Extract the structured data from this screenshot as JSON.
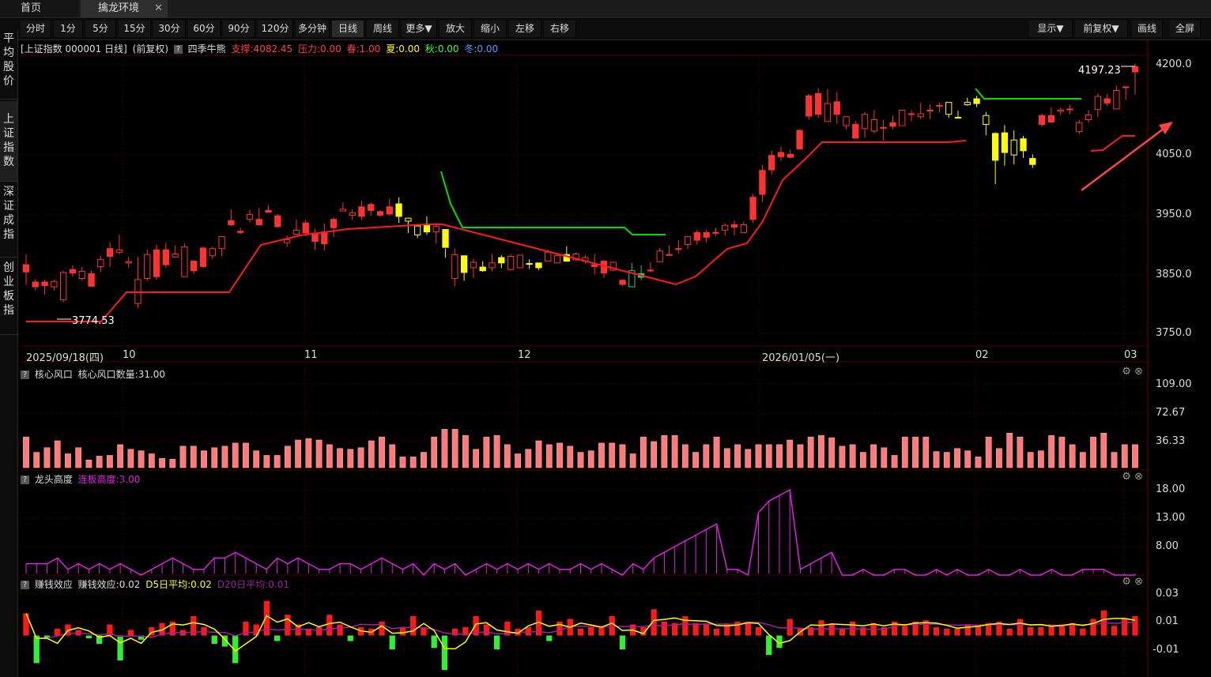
{
  "tabs": {
    "home": "首页",
    "active": "擒龙环境",
    "close_glyph": "✕"
  },
  "toolbar": {
    "left": [
      "分时",
      "1分",
      "5分",
      "15分",
      "30分",
      "60分",
      "90分",
      "120分",
      "多分钟",
      "日线",
      "周线",
      "更多▼",
      "放大",
      "缩小",
      "左移",
      "右移"
    ],
    "active": "日线",
    "right": [
      "显示▼",
      "前复权▼",
      "画线",
      "全屏"
    ]
  },
  "sidebar": [
    {
      "label": "平均股价",
      "chars": [
        "平",
        "均",
        "股",
        "价"
      ]
    },
    {
      "label": "上证指数",
      "chars": [
        "上",
        "证",
        "指",
        "数"
      ],
      "active": true
    },
    {
      "label": "深证成指",
      "chars": [
        "深",
        "证",
        "成",
        "指"
      ]
    },
    {
      "label": "创业板指",
      "chars": [
        "创",
        "业",
        "板",
        "指"
      ]
    }
  ],
  "main_info": {
    "title": "[上证指数 000001 日线]",
    "adjust": "(前复权)",
    "question": "?",
    "indicator": "四季牛熊",
    "support": "支撑:4082.45",
    "pressure": "压力:0.00",
    "spring": "春:1.00",
    "summer": "夏:0.00",
    "autumn": "秋:0.00",
    "winter": "冬:0.00"
  },
  "annotations": {
    "high": "4197.23",
    "low": "3774.53"
  },
  "price_axis": [
    "4200.0",
    "4050.0",
    "3950.0",
    "3850.0",
    "3750.0"
  ],
  "date_axis": [
    "2025/09/18(四)",
    "10",
    "11",
    "12",
    "2026/01/05(一)",
    "02",
    "03"
  ],
  "panels": {
    "core": {
      "name": "核心风口",
      "field": "核心风口数量:31.00",
      "axis": [
        "109.00",
        "72.67",
        "36.33"
      ]
    },
    "dragon": {
      "name": "龙头高度",
      "field": "连板高度:3.00",
      "axis": [
        "18.00",
        "13.00",
        "8.00"
      ]
    },
    "money": {
      "name": "赚钱效应",
      "field": "赚钱效应:0.02",
      "d5": "D5日平均:0.02",
      "d20": "D20日平均:0.01",
      "axis": [
        "0.03",
        "0.01",
        "-0.01"
      ]
    }
  },
  "colors": {
    "up": "#ff3333",
    "down": "#ff3333",
    "yellow": "#ffff00",
    "green_line": "#00dd00",
    "red_line": "#ff1a1a",
    "magenta": "#e020e0",
    "volume": "#ff6e6e"
  },
  "icons": {
    "settings": "gear-icon",
    "close": "close-icon",
    "question": "help-icon"
  },
  "chart_data": [
    {
      "type": "candlestick",
      "title": "[上证指数 000001 日线]",
      "ylim": [
        3740,
        4210
      ],
      "y_ticks": [
        4200,
        4050,
        3950,
        3850,
        3750
      ],
      "x_ticks": [
        "2025/09/18(四)",
        "10",
        "11",
        "12",
        "2026/01/05(一)",
        "02",
        "03"
      ],
      "candles": [
        [
          3865,
          3853,
          3882,
          3831
        ],
        [
          3836,
          3828,
          3841,
          3822
        ],
        [
          3836,
          3830,
          3840,
          3815
        ],
        [
          3828,
          3837,
          3840,
          3822
        ],
        [
          3806,
          3852,
          3855,
          3802
        ],
        [
          3857,
          3851,
          3864,
          3845
        ],
        [
          3842,
          3854,
          3861,
          3839
        ],
        [
          3850,
          3829,
          3855,
          3829
        ],
        [
          3862,
          3874,
          3880,
          3853
        ],
        [
          3892,
          3879,
          3903,
          3861
        ],
        [
          3886,
          3890,
          3915,
          3882
        ],
        [
          3868,
          3870,
          3878,
          3860
        ],
        [
          3800,
          3840,
          3878,
          3792
        ],
        [
          3842,
          3882,
          3890,
          3838
        ],
        [
          3890,
          3845,
          3899,
          3840
        ],
        [
          3890,
          3865,
          3902,
          3860
        ],
        [
          3878,
          3883,
          3897,
          3877
        ],
        [
          3845,
          3895,
          3900,
          3847
        ],
        [
          3871,
          3855,
          3872,
          3850
        ],
        [
          3893,
          3862,
          3895,
          3860
        ],
        [
          3880,
          3892,
          3895,
          3875
        ],
        [
          3892,
          3912,
          3910,
          3879
        ],
        [
          3939,
          3932,
          3958,
          3930
        ],
        [
          3921,
          3919,
          3927,
          3916
        ],
        [
          3941,
          3949,
          3957,
          3936
        ],
        [
          3941,
          3932,
          3960,
          3932
        ],
        [
          3956,
          3953,
          3965,
          3952
        ],
        [
          3947,
          3929,
          3950,
          3927
        ],
        [
          3902,
          3907,
          3914,
          3895
        ],
        [
          3916,
          3923,
          3941,
          3915
        ],
        [
          3935,
          3918,
          3940,
          3913
        ],
        [
          3918,
          3904,
          3925,
          3890
        ],
        [
          3920,
          3900,
          3934,
          3889
        ],
        [
          3941,
          3927,
          3944,
          3911
        ],
        [
          3955,
          3958,
          3969,
          3955
        ],
        [
          3948,
          3952,
          3958,
          3940
        ],
        [
          3962,
          3946,
          3972,
          3940
        ],
        [
          3966,
          3956,
          3969,
          3947
        ],
        [
          3954,
          3948,
          3957,
          3945
        ],
        [
          3962,
          3950,
          3976,
          3947
        ],
        [
          3967,
          3946,
          3978,
          3935
        ],
        [
          3938,
          3943,
          3944,
          3918
        ],
        [
          3915,
          3930,
          3923,
          3910
        ],
        [
          3932,
          3920,
          3946,
          3915
        ],
        [
          3920,
          3929,
          3935,
          3900
        ],
        [
          3924,
          3894,
          3892,
          3877
        ],
        [
          3842,
          3882,
          3892,
          3829
        ],
        [
          3880,
          3852,
          3870,
          3838
        ],
        [
          3860,
          3869,
          3875,
          3843
        ],
        [
          3861,
          3855,
          3871,
          3853
        ],
        [
          3860,
          3868,
          3883,
          3854
        ],
        [
          3877,
          3868,
          3881,
          3859
        ],
        [
          3857,
          3879,
          3883,
          3856
        ],
        [
          3860,
          3881,
          3874,
          3862
        ],
        [
          3867,
          3866,
          3874,
          3858
        ],
        [
          3868,
          3860,
          3867,
          3856
        ],
        [
          3871,
          3886,
          3890,
          3870
        ],
        [
          3868,
          3880,
          3885,
          3868
        ],
        [
          3882,
          3871,
          3896,
          3870
        ],
        [
          3873,
          3883,
          3886,
          3872
        ],
        [
          3871,
          3877,
          3881,
          3867
        ],
        [
          3865,
          3862,
          3883,
          3849
        ],
        [
          3871,
          3851,
          3865,
          3843
        ],
        [
          3856,
          3869,
          3870,
          3854
        ],
        [
          3839,
          3832,
          3840,
          3830
        ],
        [
          3828,
          3855,
          3868,
          3831
        ],
        [
          3850,
          3844,
          3864,
          3839
        ],
        [
          3856,
          3855,
          3869,
          3852
        ],
        [
          3870,
          3888,
          3893,
          3872
        ],
        [
          3881,
          3882,
          3897,
          3880
        ],
        [
          3891,
          3892,
          3906,
          3884
        ],
        [
          3899,
          3912,
          3910,
          3891
        ],
        [
          3919,
          3906,
          3923,
          3899
        ],
        [
          3919,
          3911,
          3923,
          3902
        ],
        [
          3919,
          3919,
          3927,
          3913
        ],
        [
          3923,
          3931,
          3934,
          3914
        ],
        [
          3932,
          3928,
          3939,
          3914
        ],
        [
          3919,
          3932,
          3937,
          3918
        ],
        [
          3978,
          3941,
          3984,
          3935
        ],
        [
          4023,
          3983,
          4032,
          3970
        ],
        [
          4048,
          4024,
          4056,
          4016
        ],
        [
          4053,
          4046,
          4063,
          4039
        ],
        [
          4050,
          4045,
          4058,
          4044
        ],
        [
          4090,
          4059,
          4092,
          4058
        ],
        [
          4148,
          4114,
          4151,
          4108
        ],
        [
          4152,
          4117,
          4161,
          4111
        ],
        [
          4105,
          4135,
          4159,
          4105
        ],
        [
          4138,
          4117,
          4154,
          4101
        ],
        [
          4098,
          4113,
          4111,
          4092
        ],
        [
          4100,
          4077,
          4106,
          4080
        ],
        [
          4093,
          4117,
          4121,
          4078
        ],
        [
          4089,
          4108,
          4124,
          4085
        ],
        [
          4095,
          4095,
          4108,
          4073
        ],
        [
          4103,
          4097,
          4115,
          4092
        ],
        [
          4098,
          4124,
          4105,
          4099
        ],
        [
          4118,
          4118,
          4123,
          4105
        ],
        [
          4113,
          4118,
          4137,
          4109
        ],
        [
          4124,
          4124,
          4134,
          4109
        ],
        [
          4132,
          4132,
          4136,
          4120
        ],
        [
          4117,
          4137,
          4135,
          4111
        ],
        [
          4112,
          4112,
          4123,
          4111
        ],
        [
          4133,
          4137,
          4145,
          4131
        ],
        [
          4143,
          4135,
          4148,
          4129
        ],
        [
          4100,
          4115,
          4121,
          4082
        ],
        [
          4085,
          4040,
          4087,
          4000
        ],
        [
          4086,
          4053,
          4099,
          4031
        ],
        [
          4049,
          4074,
          4090,
          4033
        ],
        [
          4076,
          4056,
          4081,
          4044
        ],
        [
          4043,
          4033,
          4050,
          4027
        ],
        [
          4115,
          4100,
          4118,
          4096
        ],
        [
          4115,
          4104,
          4129,
          4104
        ],
        [
          4122,
          4124,
          4128,
          4116
        ],
        [
          4126,
          4126,
          4133,
          4117
        ],
        [
          4088,
          4103,
          4108,
          4084
        ],
        [
          4108,
          4116,
          4124,
          4103
        ],
        [
          4125,
          4147,
          4152,
          4112
        ],
        [
          4143,
          4136,
          4151,
          4131
        ],
        [
          4126,
          4157,
          4165,
          4129
        ],
        [
          4163,
          4163,
          4164,
          4141
        ],
        [
          4197,
          4188,
          4202,
          4150
        ]
      ]
    },
    {
      "type": "bar",
      "name": "核心风口数量",
      "ylim": [
        0,
        109
      ],
      "values": [
        40,
        20,
        26,
        35,
        18,
        26,
        10,
        15,
        16,
        30,
        24,
        22,
        18,
        12,
        11,
        28,
        28,
        22,
        26,
        28,
        32,
        32,
        22,
        16,
        16,
        28,
        36,
        38,
        36,
        30,
        25,
        24,
        26,
        35,
        40,
        30,
        14,
        14,
        20,
        40,
        50,
        50,
        42,
        24,
        40,
        42,
        30,
        18,
        24,
        35,
        30,
        32,
        28,
        20,
        22,
        32,
        32,
        30,
        18,
        40,
        34,
        42,
        42,
        30,
        20,
        30,
        40,
        25,
        30,
        24,
        30,
        30,
        30,
        36,
        30,
        40,
        42,
        39,
        28,
        30,
        20,
        30,
        26,
        16,
        40,
        40,
        40,
        21,
        20,
        25,
        22,
        14,
        40,
        25,
        45,
        40,
        20,
        22,
        42,
        40,
        30,
        20,
        40,
        45,
        20,
        30,
        30
      ],
      "latest": 31.0
    },
    {
      "type": "line",
      "name": "连板高度",
      "ylim": [
        3,
        18
      ],
      "values": [
        5,
        5,
        5,
        6,
        4,
        5,
        4,
        5,
        4,
        5,
        4,
        3,
        4,
        5,
        6,
        5,
        4,
        4,
        6,
        6,
        7,
        6,
        5,
        4,
        6,
        5,
        6,
        5,
        4,
        4,
        5,
        5,
        4,
        5,
        6,
        5,
        4,
        5,
        3,
        5,
        4,
        5,
        3,
        4,
        5,
        4,
        5,
        4,
        5,
        4,
        5,
        4,
        4,
        5,
        4,
        5,
        4,
        3,
        5,
        4,
        6,
        7,
        8,
        9,
        10,
        11,
        12,
        4,
        4,
        3,
        14,
        16,
        17,
        18,
        4,
        5,
        6,
        7,
        3,
        3,
        4,
        3,
        3,
        4,
        4,
        3,
        3,
        4,
        3,
        4,
        3,
        3,
        4,
        3,
        3,
        4,
        3,
        3,
        4,
        3,
        3,
        4,
        4,
        4,
        3,
        3,
        3
      ],
      "latest": 3.0
    },
    {
      "type": "bar",
      "name": "赚钱效应",
      "ylim": [
        -0.027,
        0.033
      ],
      "values": [
        0.016,
        -0.02,
        -0.002,
        0.005,
        0.008,
        0.004,
        -0.002,
        -0.006,
        0.008,
        -0.018,
        0.004,
        -0.003,
        0.006,
        0.009,
        0.01,
        0.004,
        0.014,
        0.006,
        -0.006,
        -0.008,
        -0.02,
        0.01,
        0.008,
        0.025,
        -0.004,
        0.015,
        0.008,
        0.005,
        0.006,
        0.015,
        0.008,
        -0.004,
        0.006,
        0.005,
        0.01,
        -0.01,
        0.006,
        0.014,
        0.006,
        -0.009,
        -0.025,
        0.005,
        0.006,
        0.014,
        0.008,
        -0.01,
        0.01,
        0.005,
        0.006,
        0.018,
        -0.004,
        0.01,
        0.012,
        0.005,
        0.006,
        0.007,
        0.014,
        -0.01,
        0.008,
        0.006,
        0.019,
        0.01,
        0.009,
        0.014,
        0.009,
        0.008,
        0.005,
        0.008,
        0.01,
        0.01,
        0.006,
        -0.014,
        -0.009,
        0.012,
        0.005,
        0.006,
        0.011,
        0.008,
        0.005,
        0.01,
        0.006,
        0.009,
        0.006,
        0.01,
        0.007,
        0.01,
        0.011,
        0.006,
        0.005,
        0.005,
        0.008,
        0.007,
        0.009,
        0.01,
        0.005,
        0.012,
        0.006,
        0.006,
        0.008,
        0.008,
        0.009,
        0.005,
        0.012,
        0.018,
        0.007,
        0.012,
        0.014
      ],
      "d5_latest": 0.02,
      "d20_latest": 0.01
    }
  ]
}
